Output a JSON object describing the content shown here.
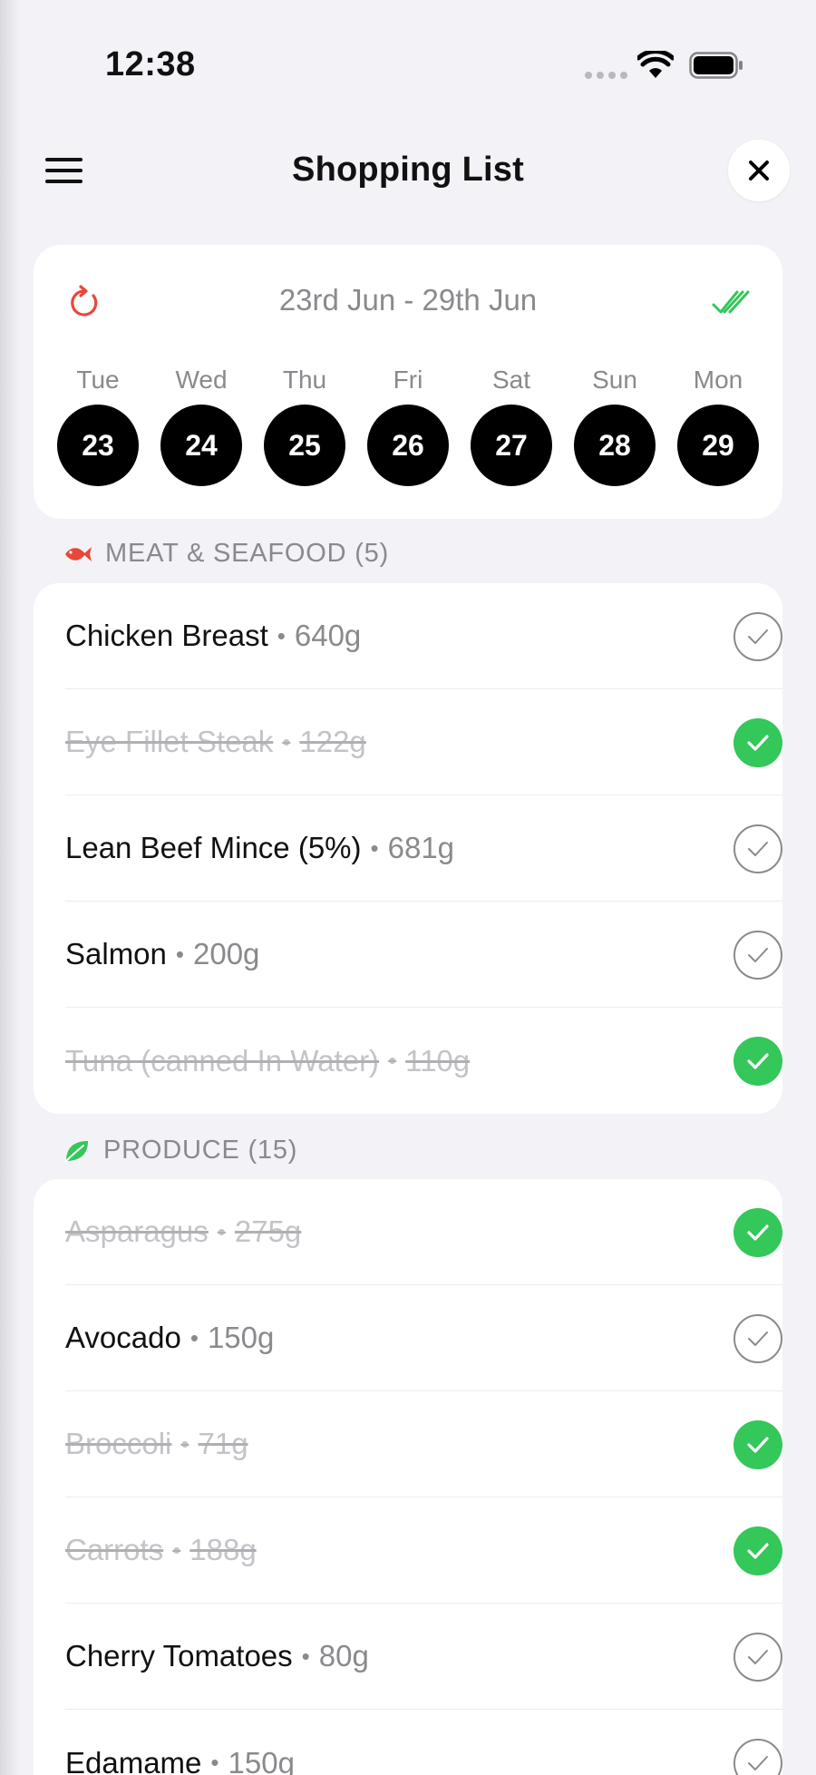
{
  "status_bar": {
    "time": "12:38"
  },
  "header": {
    "title": "Shopping List"
  },
  "week": {
    "range": "23rd Jun - 29th Jun",
    "days": [
      {
        "name": "Tue",
        "date": "23"
      },
      {
        "name": "Wed",
        "date": "24"
      },
      {
        "name": "Thu",
        "date": "25"
      },
      {
        "name": "Fri",
        "date": "26"
      },
      {
        "name": "Sat",
        "date": "27"
      },
      {
        "name": "Sun",
        "date": "28"
      },
      {
        "name": "Mon",
        "date": "29"
      }
    ]
  },
  "colors": {
    "accent_red": "#e8473a",
    "accent_green": "#34c759",
    "check_grey": "#8a8a8e"
  },
  "sections": [
    {
      "title": "MEAT & SEAFOOD (5)",
      "icon": "fish-icon",
      "items": [
        {
          "name": "Chicken Breast",
          "qty": "640g",
          "checked": false
        },
        {
          "name": "Eye Fillet Steak",
          "qty": "122g",
          "checked": true
        },
        {
          "name": "Lean Beef Mince (5%)",
          "qty": "681g",
          "checked": false
        },
        {
          "name": "Salmon",
          "qty": "200g",
          "checked": false
        },
        {
          "name": "Tuna (canned In Water)",
          "qty": "110g",
          "checked": true
        }
      ]
    },
    {
      "title": "PRODUCE (15)",
      "icon": "leaf-icon",
      "items": [
        {
          "name": "Asparagus",
          "qty": "275g",
          "checked": true
        },
        {
          "name": "Avocado",
          "qty": "150g",
          "checked": false
        },
        {
          "name": "Broccoli",
          "qty": "71g",
          "checked": true
        },
        {
          "name": "Carrots",
          "qty": "188g",
          "checked": true
        },
        {
          "name": "Cherry Tomatoes",
          "qty": "80g",
          "checked": false
        },
        {
          "name": "Edamame",
          "qty": "150g",
          "checked": false
        }
      ]
    }
  ]
}
